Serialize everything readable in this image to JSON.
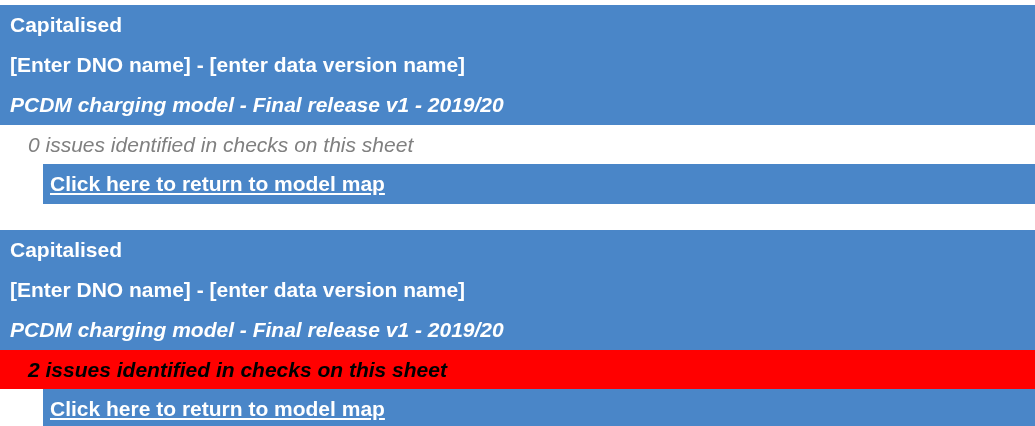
{
  "sheets": [
    {
      "title": "Capitalised",
      "dno_line": "[Enter DNO name] - [enter data version name]",
      "model_line": "PCDM charging model - Final release v1 - 2019/20",
      "issues": {
        "text": "0 issues identified in checks on this sheet",
        "flagged": false
      },
      "link": "Click here to return to model map"
    },
    {
      "title": "Capitalised",
      "dno_line": "[Enter DNO name] - [enter data version name]",
      "model_line": "PCDM charging model - Final release v1 - 2019/20",
      "issues": {
        "text": "2 issues identified in checks on this sheet",
        "flagged": true
      },
      "link": "Click here to return to model map"
    }
  ]
}
